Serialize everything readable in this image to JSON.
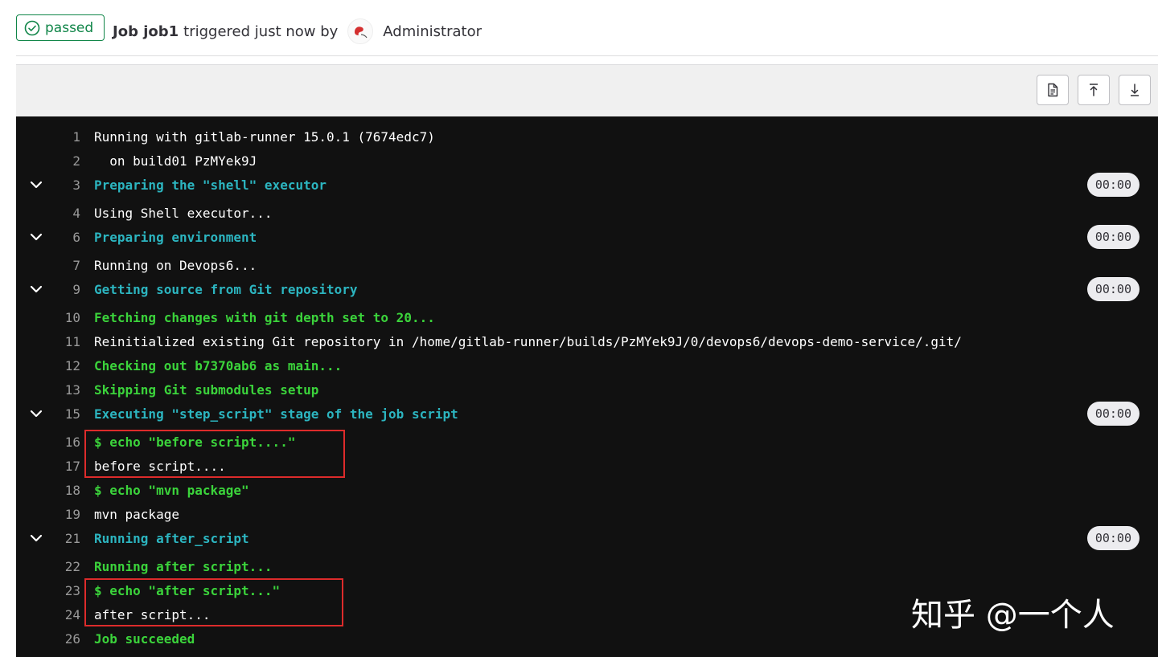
{
  "header": {
    "status": "passed",
    "job_label": "Job job1",
    "triggered_text": "triggered just now by",
    "user": "Administrator"
  },
  "toolbar": {
    "buttons": [
      {
        "name": "raw-log-button",
        "icon": "file-icon"
      },
      {
        "name": "scroll-to-top-button",
        "icon": "arrow-up-icon"
      },
      {
        "name": "scroll-to-bottom-button",
        "icon": "arrow-down-icon"
      }
    ]
  },
  "log": {
    "lines": [
      {
        "num": "1",
        "text": "Running with gitlab-runner 15.0.1 (7674edc7)",
        "color": "white"
      },
      {
        "num": "2",
        "text": "  on build01 PzMYek9J",
        "color": "white"
      },
      {
        "num": "3",
        "text": "Preparing the \"shell\" executor",
        "color": "cyan",
        "section": true,
        "duration": "00:00"
      },
      {
        "num": "4",
        "text": "Using Shell executor...",
        "color": "white"
      },
      {
        "num": "6",
        "text": "Preparing environment",
        "color": "cyan",
        "section": true,
        "duration": "00:00"
      },
      {
        "num": "7",
        "text": "Running on Devops6...",
        "color": "white"
      },
      {
        "num": "9",
        "text": "Getting source from Git repository",
        "color": "cyan",
        "section": true,
        "duration": "00:00"
      },
      {
        "num": "10",
        "text": "Fetching changes with git depth set to 20...",
        "color": "green"
      },
      {
        "num": "11",
        "text": "Reinitialized existing Git repository in /home/gitlab-runner/builds/PzMYek9J/0/devops6/devops-demo-service/.git/",
        "color": "white"
      },
      {
        "num": "12",
        "text": "Checking out b7370ab6 as main...",
        "color": "green"
      },
      {
        "num": "13",
        "text": "Skipping Git submodules setup",
        "color": "green"
      },
      {
        "num": "15",
        "text": "Executing \"step_script\" stage of the job script",
        "color": "cyan",
        "section": true,
        "duration": "00:00"
      },
      {
        "num": "16",
        "text": "$ echo \"before script....\"",
        "color": "green"
      },
      {
        "num": "17",
        "text": "before script....",
        "color": "white"
      },
      {
        "num": "18",
        "text": "$ echo \"mvn package\"",
        "color": "green"
      },
      {
        "num": "19",
        "text": "mvn package",
        "color": "white"
      },
      {
        "num": "21",
        "text": "Running after_script",
        "color": "cyan",
        "section": true,
        "duration": "00:00"
      },
      {
        "num": "22",
        "text": "Running after script...",
        "color": "green"
      },
      {
        "num": "23",
        "text": "$ echo \"after script...\"",
        "color": "green"
      },
      {
        "num": "24",
        "text": "after script...",
        "color": "white"
      },
      {
        "num": "26",
        "text": "Job succeeded",
        "color": "green"
      }
    ]
  },
  "watermark": "知乎 @一个人"
}
